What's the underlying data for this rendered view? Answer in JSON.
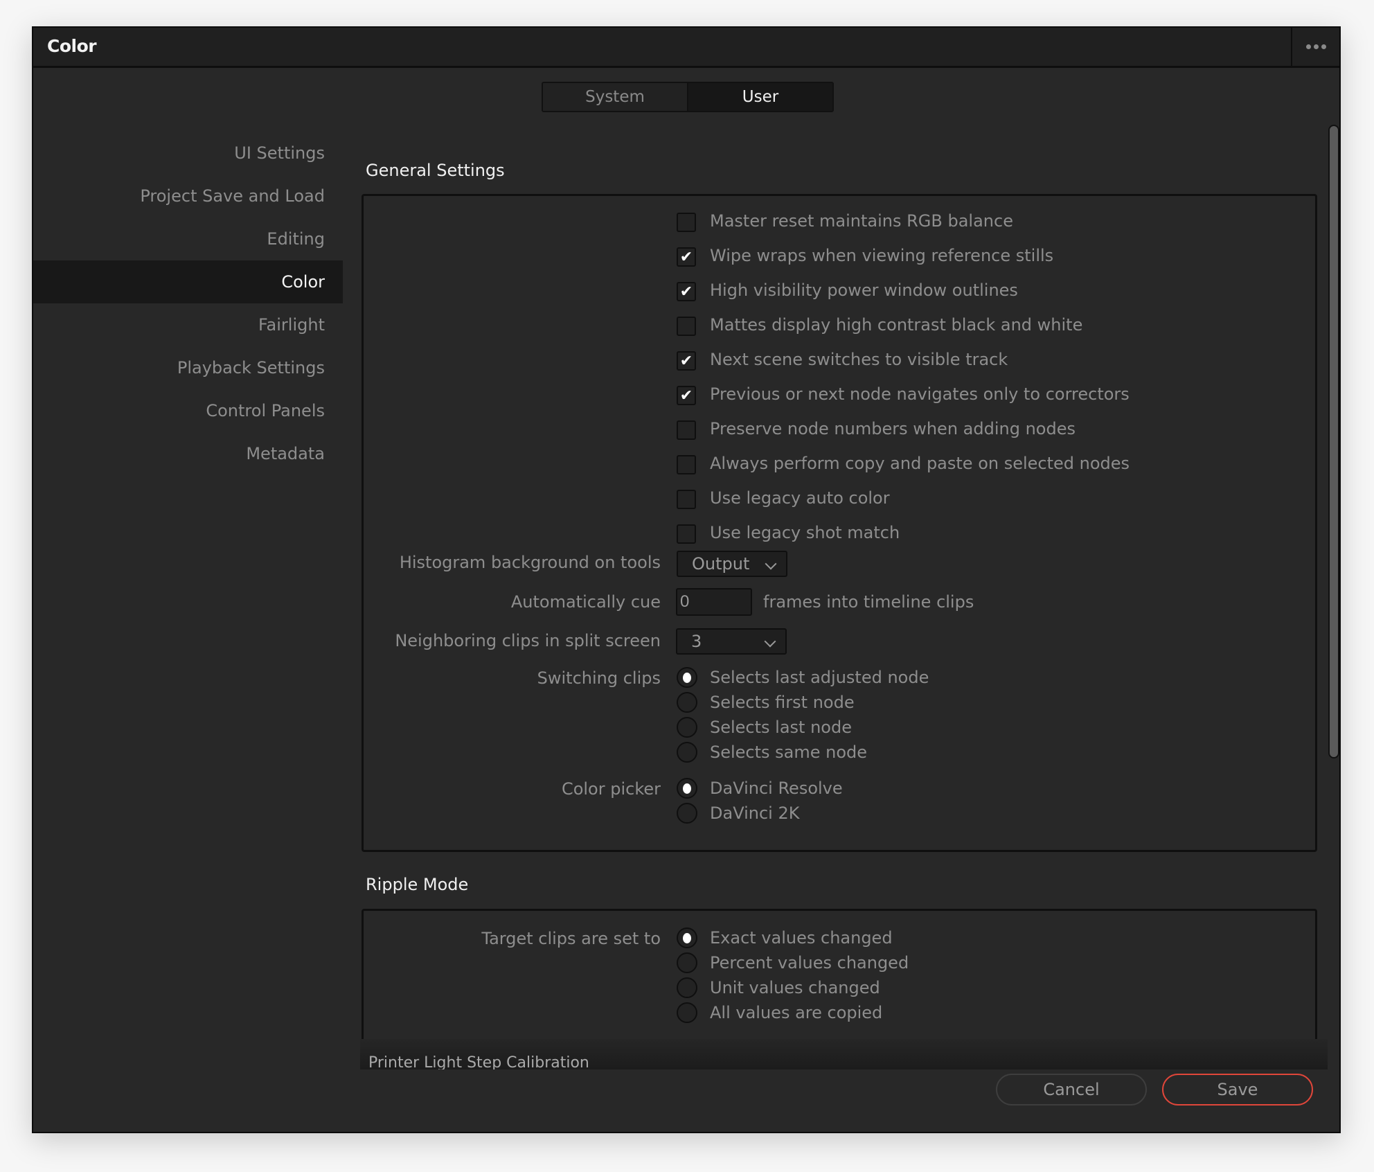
{
  "window": {
    "title": "Color",
    "more_icon": "ellipsis-icon"
  },
  "tabs": [
    {
      "label": "System",
      "active": false
    },
    {
      "label": "User",
      "active": true
    }
  ],
  "sidebar": {
    "items": [
      {
        "label": "UI Settings",
        "active": false
      },
      {
        "label": "Project Save and Load",
        "active": false
      },
      {
        "label": "Editing",
        "active": false
      },
      {
        "label": "Color",
        "active": true
      },
      {
        "label": "Fairlight",
        "active": false
      },
      {
        "label": "Playback Settings",
        "active": false
      },
      {
        "label": "Control Panels",
        "active": false
      },
      {
        "label": "Metadata",
        "active": false
      }
    ]
  },
  "general": {
    "title": "General Settings",
    "checkboxes": [
      {
        "label": "Master reset maintains RGB balance",
        "checked": false
      },
      {
        "label": "Wipe wraps when viewing reference stills",
        "checked": true
      },
      {
        "label": "High visibility power window outlines",
        "checked": true
      },
      {
        "label": "Mattes display high contrast black and white",
        "checked": false
      },
      {
        "label": "Next scene switches to visible track",
        "checked": true
      },
      {
        "label": "Previous or next node navigates only to correctors",
        "checked": true
      },
      {
        "label": "Preserve node numbers when adding nodes",
        "checked": false
      },
      {
        "label": "Always perform copy and paste on selected nodes",
        "checked": false
      },
      {
        "label": "Use legacy auto color",
        "checked": false
      },
      {
        "label": "Use legacy shot match",
        "checked": false
      }
    ],
    "histogram": {
      "label": "Histogram background on tools",
      "value": "Output"
    },
    "auto_cue": {
      "label": "Automatically cue",
      "value": "0",
      "suffix": "frames into timeline clips"
    },
    "neighboring": {
      "label": "Neighboring clips in split screen",
      "value": "3"
    },
    "switching": {
      "label": "Switching clips",
      "options": [
        {
          "label": "Selects last adjusted node",
          "selected": true
        },
        {
          "label": "Selects first node",
          "selected": false
        },
        {
          "label": "Selects last node",
          "selected": false
        },
        {
          "label": "Selects same node",
          "selected": false
        }
      ]
    },
    "color_picker": {
      "label": "Color picker",
      "options": [
        {
          "label": "DaVinci Resolve",
          "selected": true
        },
        {
          "label": "DaVinci 2K",
          "selected": false
        }
      ]
    }
  },
  "ripple": {
    "title": "Ripple Mode",
    "label": "Target clips are set to",
    "options": [
      {
        "label": "Exact values changed",
        "selected": true
      },
      {
        "label": "Percent values changed",
        "selected": false
      },
      {
        "label": "Unit values changed",
        "selected": false
      },
      {
        "label": "All values are copied",
        "selected": false
      }
    ]
  },
  "next_section": {
    "title": "Printer Light Step Calibration"
  },
  "footer": {
    "cancel_label": "Cancel",
    "save_label": "Save",
    "save_accent": "#e0463a"
  }
}
